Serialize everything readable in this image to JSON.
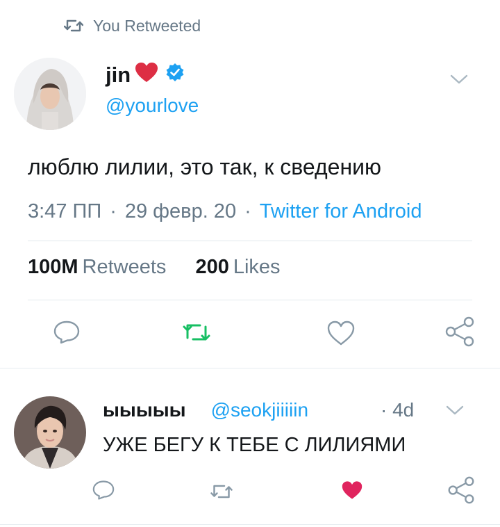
{
  "retweet_context": {
    "label": "You Retweeted"
  },
  "tweet": {
    "author_name": "jin",
    "author_emoji": "❤️",
    "verified": true,
    "handle": "@yourlove",
    "text": "люблю лилии, это так, к сведению",
    "time": "3:47 ПП",
    "date": "29 февр. 20",
    "separator": "·",
    "client": "Twitter for Android",
    "retweet_count": "100M",
    "retweet_label": "Retweets",
    "like_count": "200",
    "like_label": "Likes",
    "retweeted": true
  },
  "reply": {
    "author_name": "ыыыыы",
    "handle": "@seokjiiiiin",
    "time": "· 4d",
    "text": "УЖЕ БЕГУ К ТЕБЕ С ЛИЛИЯМИ",
    "liked": true
  },
  "colors": {
    "accent": "#1da1f2",
    "retweet_green": "#17bf63",
    "like_red": "#e0245e",
    "secondary_text": "#657786",
    "icon_gray": "#8899a6"
  },
  "icons": [
    "retweet-icon",
    "verified-badge-icon",
    "chevron-down-icon",
    "reply-icon",
    "like-icon",
    "share-icon"
  ]
}
